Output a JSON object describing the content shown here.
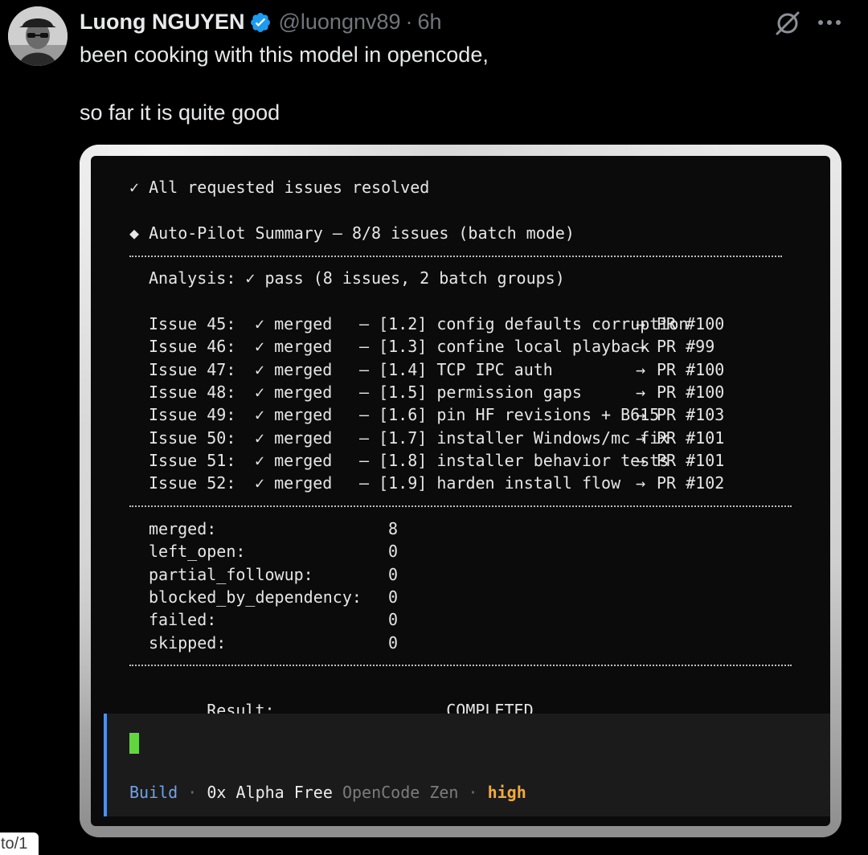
{
  "tweet": {
    "author_name": "Luong NGUYEN",
    "verified": true,
    "handle": "@luongnv89",
    "separator": "·",
    "time": "6h",
    "text_line_1": "been cooking with this model in opencode,",
    "text_line_2": "so far it is quite good",
    "icons": {
      "grok": "grok-icon",
      "more": "more-icon",
      "verified": "verified-badge-icon"
    },
    "colors": {
      "verified": "#1d9bf0",
      "text": "#e7e9ea",
      "muted": "#71767b"
    }
  },
  "terminal": {
    "resolved_line": "✓ All requested issues resolved",
    "summary_line": "◆ Auto-Pilot Summary — 8/8 issues (batch mode)",
    "analysis_line": "Analysis: ✓ pass (8 issues, 2 batch groups)",
    "issues": [
      {
        "label": "Issue 45:",
        "status": "✓ merged",
        "desc": "— [1.2] config defaults corruption",
        "arrow": "→",
        "pr": "PR #100"
      },
      {
        "label": "Issue 46:",
        "status": "✓ merged",
        "desc": "— [1.3] confine local playback",
        "arrow": "→",
        "pr": "PR #99"
      },
      {
        "label": "Issue 47:",
        "status": "✓ merged",
        "desc": "— [1.4] TCP IPC auth",
        "arrow": "→",
        "pr": "PR #100"
      },
      {
        "label": "Issue 48:",
        "status": "✓ merged",
        "desc": "— [1.5] permission gaps",
        "arrow": "→",
        "pr": "PR #100"
      },
      {
        "label": "Issue 49:",
        "status": "✓ merged",
        "desc": "— [1.6] pin HF revisions + B615",
        "arrow": "→",
        "pr": "PR #103"
      },
      {
        "label": "Issue 50:",
        "status": "✓ merged",
        "desc": "— [1.7] installer Windows/mc fix",
        "arrow": "→",
        "pr": "PR #101"
      },
      {
        "label": "Issue 51:",
        "status": "✓ merged",
        "desc": "— [1.8] installer behavior tests",
        "arrow": "→",
        "pr": "PR #101"
      },
      {
        "label": "Issue 52:",
        "status": "✓ merged",
        "desc": "— [1.9] harden install flow",
        "arrow": "→",
        "pr": "PR #102"
      }
    ],
    "stats": [
      {
        "key": "merged:",
        "value": "8"
      },
      {
        "key": "left_open:",
        "value": "0"
      },
      {
        "key": "partial_followup:",
        "value": "0"
      },
      {
        "key": "blocked_by_dependency:",
        "value": "0"
      },
      {
        "key": "failed:",
        "value": "0"
      },
      {
        "key": "skipped:",
        "value": "0"
      }
    ],
    "result_key": "Result:",
    "result_value": "COMPLETED",
    "input": {
      "mode": "Build",
      "separator": "·",
      "model": "0x Alpha Free",
      "provider": "OpenCode Zen",
      "variant": "high"
    },
    "colors": {
      "background": "#0b0b0b",
      "cursor": "#63d63f",
      "input_accent": "#4f8fe8",
      "mode": "#6ea3ec",
      "variant": "#f2a93b"
    }
  },
  "cut_link_text": "to/1"
}
